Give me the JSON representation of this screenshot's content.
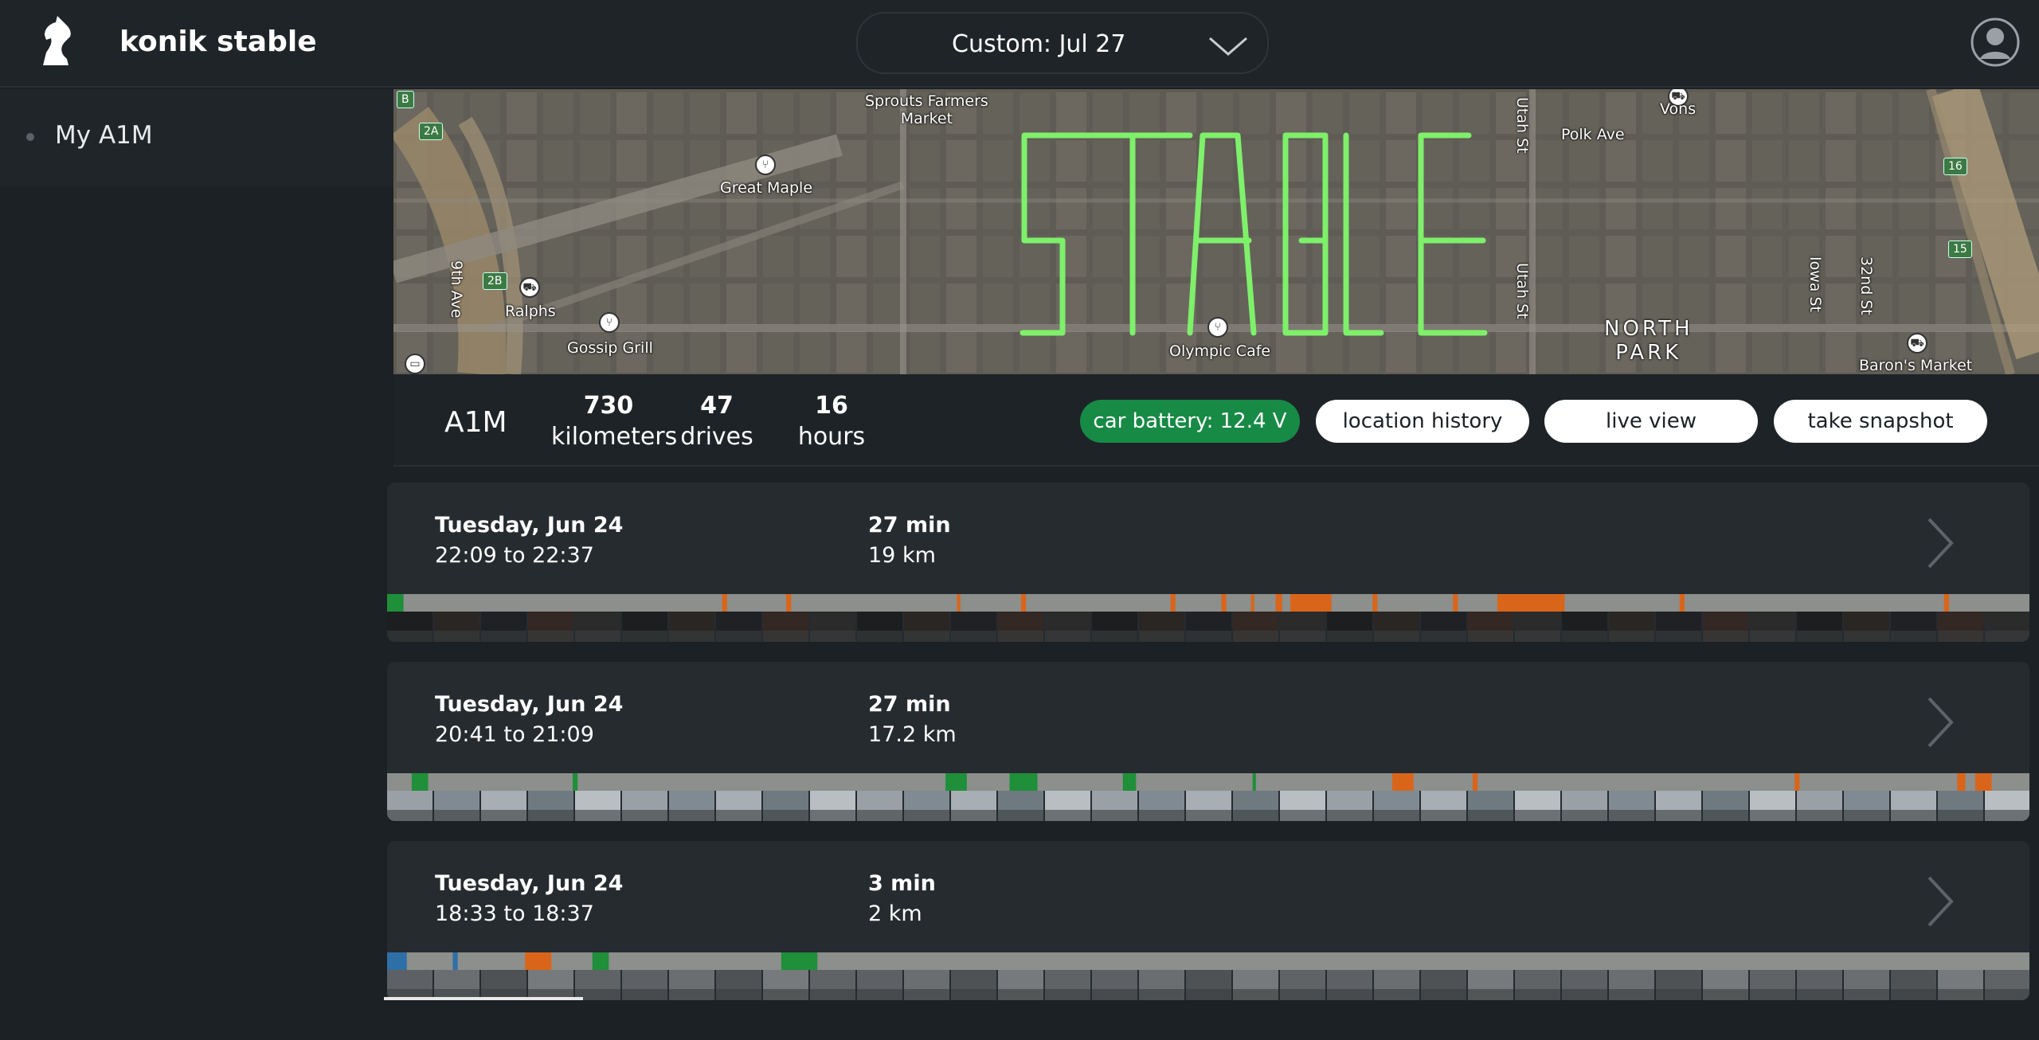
{
  "header": {
    "brand": "konik stable",
    "date_selector": "Custom: Jul 27",
    "icons": {
      "logo": "knight-chess-logo",
      "dropdown": "chevron-down-icon",
      "account": "user-avatar-icon"
    }
  },
  "sidebar": {
    "items": [
      {
        "label": "My A1M"
      }
    ]
  },
  "map": {
    "labels": {
      "sprouts": "Sprouts Farmers\nMarket",
      "great_maple": "Great Maple",
      "ninth_ave": "9th Ave",
      "ralphs": "Ralphs",
      "gossip_grill": "Gossip Grill",
      "olympic_cafe": "Olympic Cafe",
      "utah_st_1": "Utah St",
      "utah_st_2": "Utah St",
      "polk_ave": "Polk Ave",
      "vons": "Vons",
      "north_park": "NORTH\nPARK",
      "iowa_st": "Iowa St",
      "thirty_second_st": "32nd St",
      "barons_market": "Baron's Market"
    },
    "shields": {
      "b": "B",
      "r2a": "2A",
      "r2b": "2B",
      "r16": "16",
      "r15": "15"
    },
    "overlay_text": "STABLE",
    "route_color": "#7ef06a"
  },
  "stats": {
    "device": "A1M",
    "items": [
      {
        "num": "730",
        "unit": "kilometers"
      },
      {
        "num": "47",
        "unit": "drives"
      },
      {
        "num": "16",
        "unit": "hours"
      }
    ],
    "buttons": {
      "battery": "car battery: 12.4 V",
      "location_history": "location history",
      "live_view": "live view",
      "take_snapshot": "take snapshot"
    }
  },
  "drives": [
    {
      "date": "Tuesday, Jun 24",
      "time": "22:09 to 22:37",
      "duration": "27 min",
      "distance": "19 km"
    },
    {
      "date": "Tuesday, Jun 24",
      "time": "20:41 to 21:09",
      "duration": "27 min",
      "distance": "17.2 km"
    },
    {
      "date": "Tuesday, Jun 24",
      "time": "18:33 to 18:37",
      "duration": "3 min",
      "distance": "2 km"
    }
  ],
  "colors": {
    "background": "#1c2125",
    "card": "#262b30",
    "battery_green": "#178a45",
    "timeline_grey": "#8c8f8c",
    "engaged_green": "#1f8f3a",
    "alert_orange": "#d9651a",
    "route_green": "#7ef06a"
  },
  "timeline_segments": [
    [
      {
        "type": "green",
        "start": 0.0,
        "end": 0.01
      },
      {
        "type": "orange",
        "start": 0.204,
        "end": 0.207
      },
      {
        "type": "orange",
        "start": 0.243,
        "end": 0.246
      },
      {
        "type": "orange",
        "start": 0.347,
        "end": 0.349
      },
      {
        "type": "orange",
        "start": 0.386,
        "end": 0.389
      },
      {
        "type": "orange",
        "start": 0.477,
        "end": 0.48
      },
      {
        "type": "orange",
        "start": 0.508,
        "end": 0.511
      },
      {
        "type": "orange",
        "start": 0.526,
        "end": 0.528
      },
      {
        "type": "orange",
        "start": 0.541,
        "end": 0.545
      },
      {
        "type": "orange",
        "start": 0.55,
        "end": 0.575
      },
      {
        "type": "orange",
        "start": 0.6,
        "end": 0.603
      },
      {
        "type": "orange",
        "start": 0.649,
        "end": 0.652
      },
      {
        "type": "orange",
        "start": 0.676,
        "end": 0.717
      },
      {
        "type": "orange",
        "start": 0.787,
        "end": 0.79
      },
      {
        "type": "orange",
        "start": 0.948,
        "end": 0.951
      }
    ],
    [
      {
        "type": "green",
        "start": 0.015,
        "end": 0.025
      },
      {
        "type": "green",
        "start": 0.113,
        "end": 0.116
      },
      {
        "type": "green",
        "start": 0.34,
        "end": 0.353
      },
      {
        "type": "green",
        "start": 0.379,
        "end": 0.396
      },
      {
        "type": "green",
        "start": 0.448,
        "end": 0.456
      },
      {
        "type": "green",
        "start": 0.527,
        "end": 0.529
      },
      {
        "type": "orange",
        "start": 0.612,
        "end": 0.625
      },
      {
        "type": "orange",
        "start": 0.661,
        "end": 0.664
      },
      {
        "type": "orange",
        "start": 0.857,
        "end": 0.86
      },
      {
        "type": "orange",
        "start": 0.956,
        "end": 0.961
      },
      {
        "type": "orange",
        "start": 0.967,
        "end": 0.977
      }
    ],
    [
      {
        "type": "blue",
        "start": 0.0,
        "end": 0.012
      },
      {
        "type": "blue",
        "start": 0.04,
        "end": 0.043
      },
      {
        "type": "orange",
        "start": 0.084,
        "end": 0.1
      },
      {
        "type": "green",
        "start": 0.125,
        "end": 0.135
      },
      {
        "type": "green",
        "start": 0.24,
        "end": 0.262
      }
    ]
  ]
}
